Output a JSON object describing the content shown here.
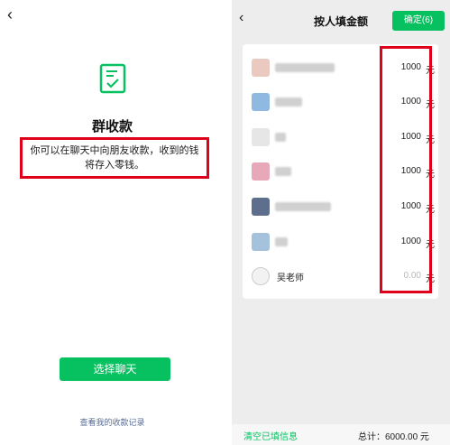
{
  "left": {
    "back_icon": "chevron-left-icon",
    "title": "群收款",
    "description_line1": "你可以在聊天中向朋友收款，收到的钱",
    "description_line2": "将存入零钱。",
    "select_chat_button": "选择聊天",
    "records_link": "查看我的收款记录"
  },
  "right": {
    "back_icon": "chevron-left-icon",
    "title": "按人填金额",
    "confirm_button": "确定(6)",
    "members": [
      {
        "name": "",
        "amount": "1000",
        "unit": "元",
        "avatar_color": "#e9c9c0"
      },
      {
        "name": "",
        "amount": "1000",
        "unit": "元",
        "avatar_color": "#8fb9e0"
      },
      {
        "name": "",
        "amount": "1000",
        "unit": "元",
        "avatar_color": "#e6e6e6"
      },
      {
        "name": "",
        "amount": "1000",
        "unit": "元",
        "avatar_color": "#e7a9b9"
      },
      {
        "name": "",
        "amount": "1000",
        "unit": "元",
        "avatar_color": "#5d6f8c"
      },
      {
        "name": "",
        "amount": "1000",
        "unit": "元",
        "avatar_color": "#a4c2dc"
      },
      {
        "name": "吴老师",
        "amount": "0.00",
        "unit": "元",
        "avatar_color": "#f2f2f2"
      }
    ],
    "clear_link": "清空已填信息",
    "total": "总计：6000.00 元"
  },
  "colors": {
    "accent_green": "#07c160",
    "highlight_red": "#e0001b",
    "link_blue": "#576b95"
  }
}
